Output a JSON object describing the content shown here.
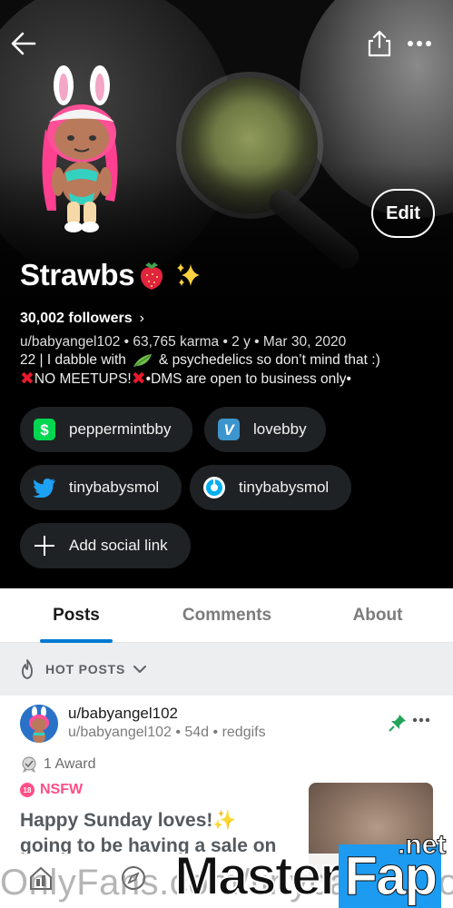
{
  "profile": {
    "display_name": "Strawbs",
    "followers": "30,002 followers",
    "meta": "u/babyangel102 • 63,765 karma • 2 y • Mar 30, 2020",
    "bio_line1_a": "22 | I dabble with",
    "bio_line1_b": "& psychedelics so don’t mind that :)",
    "bio_line2_a": "NO MEETUPS!",
    "bio_line2_b": " •DMS are open to business only•",
    "edit_label": "Edit"
  },
  "social_links": [
    {
      "label": "peppermintbby",
      "icon": "cashapp-icon"
    },
    {
      "label": "lovebby",
      "icon": "venmo-icon"
    },
    {
      "label": "tinybabysmol",
      "icon": "twitter-icon"
    },
    {
      "label": "tinybabysmol",
      "icon": "onlyfans-icon"
    },
    {
      "label": "Add social link",
      "icon": "plus-icon"
    }
  ],
  "tabs": [
    {
      "label": "Posts",
      "active": true
    },
    {
      "label": "Comments",
      "active": false
    },
    {
      "label": "About",
      "active": false
    }
  ],
  "sort": {
    "label": "HOT POSTS"
  },
  "post": {
    "user": "u/babyangel102",
    "sub": "u/babyangel102 • 54d • redgifs",
    "award": "1 Award",
    "nsfw_badge": "18",
    "nsfw": "NSFW",
    "title": "Happy Sunday loves!✨ going to be having a sale on"
  },
  "watermark": {
    "left": "OnlyFans.com/tinybabysmol",
    "brand_a": "Master",
    "brand_b": "Fap",
    "brand_c": ".net"
  },
  "colors": {
    "accent": "#0079d3",
    "nsfw": "#ff4f87",
    "cashapp": "#00d64f",
    "venmo": "#3d95ce",
    "twitter": "#1da1f2"
  }
}
